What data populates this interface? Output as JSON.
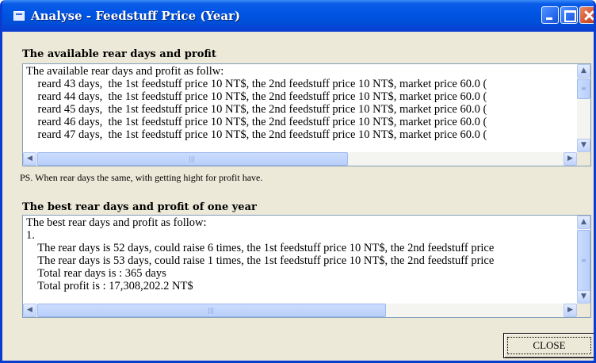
{
  "window": {
    "title": "Analyse - Feedstuff Price (Year)",
    "icon": "app-window-icon",
    "controls": [
      "minimize-icon",
      "maximize-icon",
      "close-icon"
    ]
  },
  "available": {
    "heading": "The available rear days and profit",
    "text": "The available rear days and profit as follw:\n    reard 43 days,  the 1st feedstuff price 10 NT$, the 2nd feedstuff price 10 NT$, market price 60.0 (\n    reard 44 days,  the 1st feedstuff price 10 NT$, the 2nd feedstuff price 10 NT$, market price 60.0 (\n    reard 45 days,  the 1st feedstuff price 10 NT$, the 2nd feedstuff price 10 NT$, market price 60.0 (\n    reard 46 days,  the 1st feedstuff price 10 NT$, the 2nd feedstuff price 10 NT$, market price 60.0 (\n    reard 47 days,  the 1st feedstuff price 10 NT$, the 2nd feedstuff price 10 NT$, market price 60.0 ("
  },
  "note": "PS. When rear days the same, with getting hight  for  profit have.",
  "best": {
    "heading": "The best rear days and profit of one year",
    "text": "The best rear days and profit as follow:\n1.\n    The rear days is 52 days, could raise 6 times, the 1st feedstuff price 10 NT$, the 2nd feedstuff price\n    The rear days is 53 days, could raise 1 times, the 1st feedstuff price 10 NT$, the 2nd feedstuff price\n    Total rear days is : 365 days\n    Total profit is : 17,308,202.2 NT$"
  },
  "buttons": {
    "close_label": "CLOSE"
  },
  "colors": {
    "titlebar": "#0054e3",
    "window_bg": "#ece9d8",
    "scrollbar": "#c1d3fb"
  }
}
